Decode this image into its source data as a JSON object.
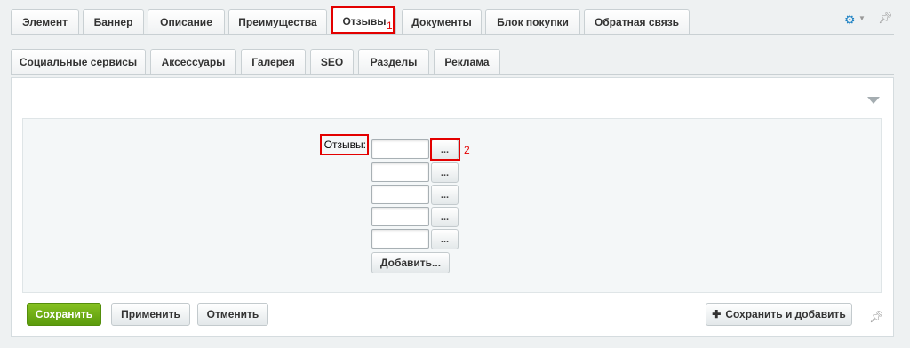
{
  "tabs_row1": [
    {
      "label": "Элемент"
    },
    {
      "label": "Баннер"
    },
    {
      "label": "Описание"
    },
    {
      "label": "Преимущества"
    },
    {
      "label": "Отзывы"
    },
    {
      "label": "Документы"
    },
    {
      "label": "Блок покупки"
    },
    {
      "label": "Обратная связь"
    }
  ],
  "tabs_row2": [
    {
      "label": "Социальные сервисы"
    },
    {
      "label": "Аксессуары"
    },
    {
      "label": "Галерея"
    },
    {
      "label": "SEO"
    },
    {
      "label": "Разделы"
    },
    {
      "label": "Реклама"
    }
  ],
  "annotations": {
    "first": "1",
    "second": "2"
  },
  "form": {
    "field_label": "Отзывы:",
    "browse_label": "...",
    "add_label": "Добавить..."
  },
  "footer": {
    "save": "Сохранить",
    "apply": "Применить",
    "cancel": "Отменить",
    "save_add": "Сохранить и добавить"
  },
  "icons": {
    "settings": "gear-icon",
    "pin": "pin-icon",
    "collapse": "chevron-down-icon",
    "plus": "plus-icon"
  }
}
